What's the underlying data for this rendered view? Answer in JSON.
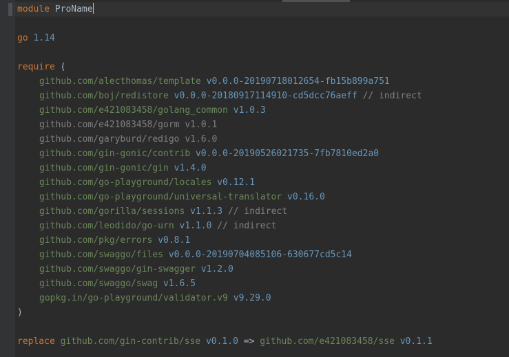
{
  "editor": {
    "module_keyword": "module",
    "module_name": "ProName",
    "go_keyword": "go",
    "go_version": "1.14",
    "require_keyword": "require",
    "open_paren": "(",
    "close_paren": ")",
    "requires": [
      {
        "path": "github.com/alecthomas/template",
        "version": "v0.0.0-20190718012654-fb15b899a751",
        "comment": ""
      },
      {
        "path": "github.com/boj/redistore",
        "version": "v0.0.0-20180917114910-cd5dcc76aeff",
        "comment": "// indirect"
      },
      {
        "path": "github.com/e421083458/golang_common",
        "version": "v1.0.3",
        "comment": ""
      },
      {
        "path": "github.com/e421083458/gorm",
        "version": "v1.0.1",
        "comment": ""
      },
      {
        "path": "github.com/garyburd/redigo",
        "version": "v1.6.0",
        "comment": ""
      },
      {
        "path": "github.com/gin-gonic/contrib",
        "version": "v0.0.0-20190526021735-7fb7810ed2a0",
        "comment": ""
      },
      {
        "path": "github.com/gin-gonic/gin",
        "version": "v1.4.0",
        "comment": ""
      },
      {
        "path": "github.com/go-playground/locales",
        "version": "v0.12.1",
        "comment": ""
      },
      {
        "path": "github.com/go-playground/universal-translator",
        "version": "v0.16.0",
        "comment": ""
      },
      {
        "path": "github.com/gorilla/sessions",
        "version": "v1.1.3",
        "comment": "// indirect"
      },
      {
        "path": "github.com/leodido/go-urn",
        "version": "v1.1.0",
        "comment": "// indirect"
      },
      {
        "path": "github.com/pkg/errors",
        "version": "v0.8.1",
        "comment": ""
      },
      {
        "path": "github.com/swaggo/files",
        "version": "v0.0.0-20190704085106-630677cd5c14",
        "comment": ""
      },
      {
        "path": "github.com/swaggo/gin-swagger",
        "version": "v1.2.0",
        "comment": ""
      },
      {
        "path": "github.com/swaggo/swag",
        "version": "v1.6.5",
        "comment": ""
      },
      {
        "path": "gopkg.in/go-playground/validator.v9",
        "version": "v9.29.0",
        "comment": ""
      }
    ],
    "replace_keyword": "replace",
    "replace_from_path": "github.com/gin-contrib/sse",
    "replace_from_version": "v0.1.0",
    "replace_arrow": "=>",
    "replace_to_path": "github.com/e421083458/sse",
    "replace_to_version": "v0.1.1"
  },
  "colors": {
    "background": "#2b2b2b",
    "keyword": "#cc7832",
    "package_path": "#6a8759",
    "version": "#6897bb",
    "comment": "#808080"
  }
}
